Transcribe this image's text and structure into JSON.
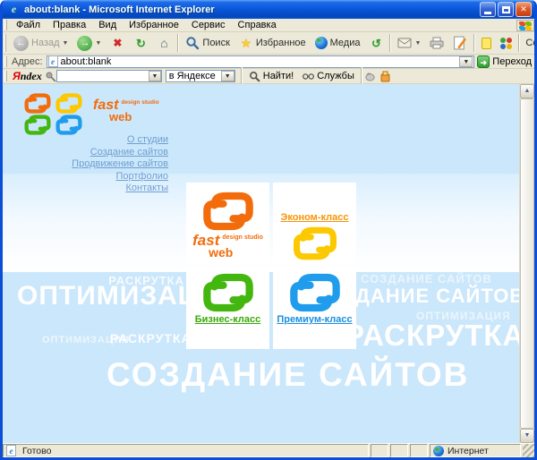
{
  "window": {
    "title": "about:blank - Microsoft Internet Explorer"
  },
  "menu": {
    "items": [
      "Файл",
      "Правка",
      "Вид",
      "Избранное",
      "Сервис",
      "Справка"
    ]
  },
  "toolbar": {
    "back": "Назад",
    "search": "Поиск",
    "favorites": "Избранное",
    "media": "Медиа",
    "links": "Ссылки"
  },
  "address": {
    "label": "Адрес:",
    "value": "about:blank",
    "go": "Переход"
  },
  "yandex": {
    "logo": "Яndex",
    "query": "",
    "scope": "в Яндексе",
    "find": "Найти!",
    "services": "Службы"
  },
  "page": {
    "logo": {
      "word1": "fast",
      "word2": "web",
      "tagline": "design studio"
    },
    "nav": [
      "О студии",
      "Создание сайтов",
      "Продвижение сайтов",
      "Портфолио",
      "Контакты"
    ],
    "tiles": {
      "fastweb": {
        "word1": "fast",
        "word2": "web",
        "tagline": "design studio"
      },
      "econom": "Эконом-класс",
      "business": "Бизнес-класс",
      "premium": "Премиум-класс"
    },
    "watermarks": [
      "РАСКРУТКА",
      "ОПТИМИЗАЦИЯ",
      "СОЗДАНИЕ САЙТОВ",
      "СОЗДАНИЕ САЙТОВ",
      "ОПТИМИЗАЦИЯ",
      "ОПТИМИЗАЦИЯ",
      "РАСКРУТКА",
      "РАСКРУТКА",
      "СОЗДАНИЕ САЙТОВ"
    ]
  },
  "status": {
    "left": "Готово",
    "zone": "Интернет"
  },
  "colors": {
    "orange": "#f26c0c",
    "yellow": "#fcc800",
    "green": "#43b60f",
    "blue": "#1f9ceb",
    "nav_link": "#6f9fd0"
  }
}
